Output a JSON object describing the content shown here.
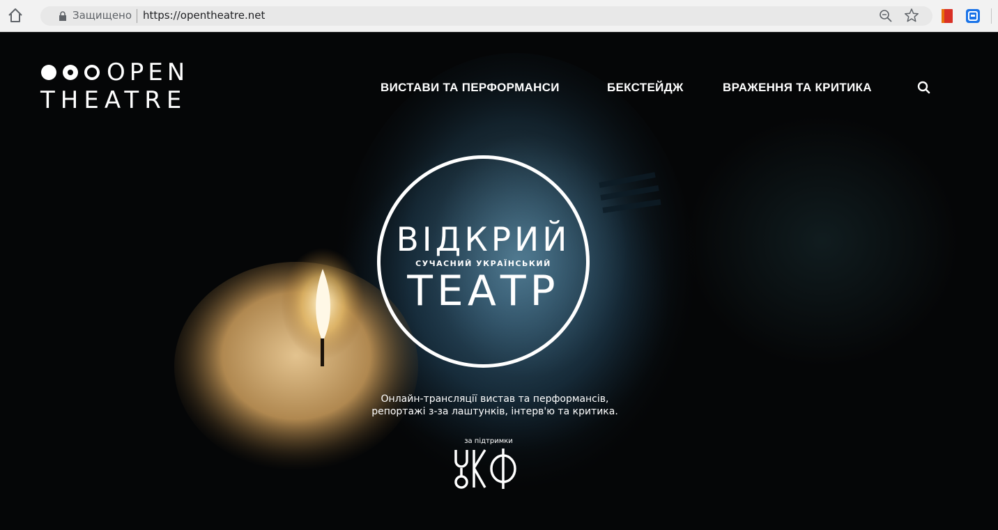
{
  "browser": {
    "secure_label": "Защищено",
    "url": "https://opentheatre.net",
    "icons": [
      "home-icon",
      "lock-icon",
      "zoom-icon",
      "star-icon",
      "extension-red-icon",
      "extension-blue-icon"
    ]
  },
  "site": {
    "logo": {
      "line1": "OPEN",
      "line2": "THEATRE"
    },
    "nav": [
      {
        "label": "ВИСТАВИ ТА ПЕРФОРМАНСИ"
      },
      {
        "label": "БЕКСТЕЙДЖ"
      },
      {
        "label": "ВРАЖЕННЯ ТА КРИТИКА"
      }
    ],
    "search_icon": "search-icon",
    "hero": {
      "circle_top": "ВІДКРИЙ",
      "circle_middle": "СУЧАСНИЙ УКРАЇНСЬКИЙ",
      "circle_bottom": "ТЕАТР",
      "tagline_line1": "Онлайн-трансляції вистав та перформансів,",
      "tagline_line2": "репортажі з-за лаштунків, інтерв'ю та критика.",
      "support_label": "за підтримки",
      "sponsor_logo": "УКФ"
    }
  },
  "colors": {
    "chrome_bg": "#f2f2f2",
    "page_bg": "#050607",
    "text": "#ffffff"
  }
}
